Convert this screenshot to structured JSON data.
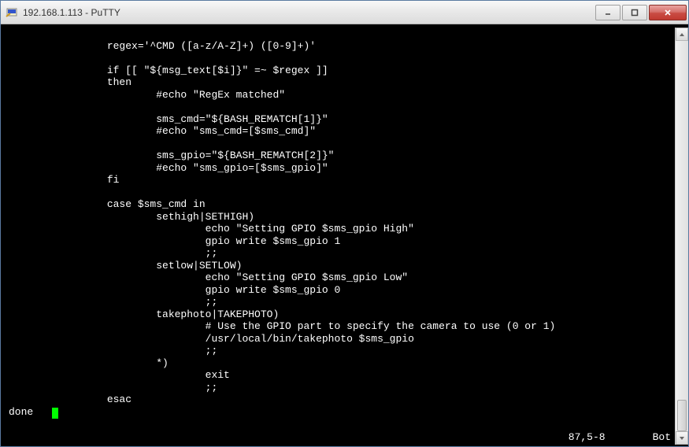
{
  "window": {
    "title": "192.168.1.113 - PuTTY"
  },
  "terminal": {
    "lines": [
      "",
      "                regex='^CMD ([a-z/A-Z]+) ([0-9]+)'",
      "",
      "                if [[ \"${msg_text[$i]}\" =~ $regex ]]",
      "                then",
      "                        #echo \"RegEx matched\"",
      "",
      "                        sms_cmd=\"${BASH_REMATCH[1]}\"",
      "                        #echo \"sms_cmd=[$sms_cmd]\"",
      "",
      "                        sms_gpio=\"${BASH_REMATCH[2]}\"",
      "                        #echo \"sms_gpio=[$sms_gpio]\"",
      "                fi",
      "",
      "                case $sms_cmd in",
      "                        sethigh|SETHIGH)",
      "                                echo \"Setting GPIO $sms_gpio High\"",
      "                                gpio write $sms_gpio 1",
      "                                ;;",
      "                        setlow|SETLOW)",
      "                                echo \"Setting GPIO $sms_gpio Low\"",
      "                                gpio write $sms_gpio 0",
      "                                ;;",
      "                        takephoto|TAKEPHOTO)",
      "                                # Use the GPIO part to specify the camera to use (0 or 1)",
      "                                /usr/local/bin/takephoto $sms_gpio",
      "                                ;;",
      "                        *)",
      "                                exit",
      "                                ;;",
      "                esac"
    ],
    "last_line_prefix": "done   ",
    "status_pos": "87,5-8",
    "status_scroll": "Bot"
  }
}
